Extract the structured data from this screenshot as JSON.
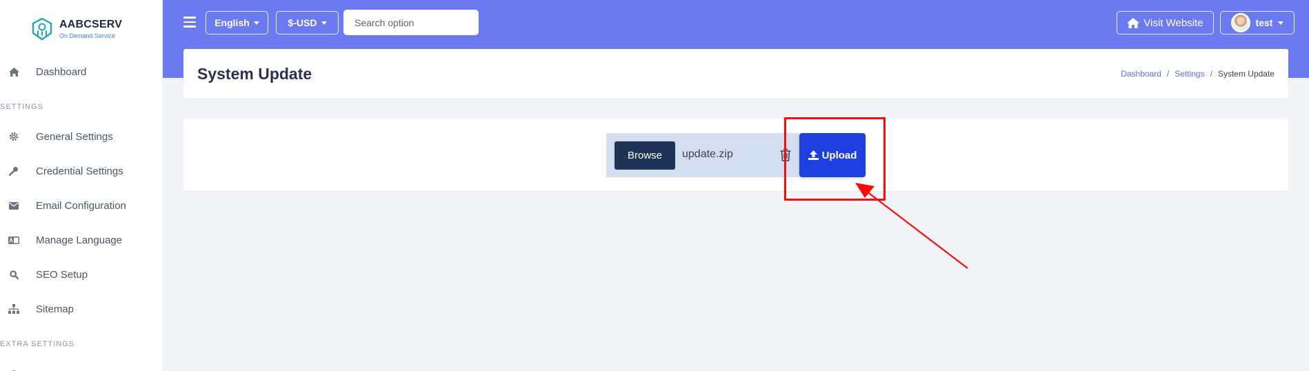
{
  "brand": {
    "name": "AABCSERV",
    "tagline": "On Demand Service"
  },
  "sidebar": {
    "items": [
      {
        "label": "Dashboard",
        "icon": "home-icon"
      },
      {
        "label": "General Settings",
        "icon": "gear-icon"
      },
      {
        "label": "Credential Settings",
        "icon": "key-icon"
      },
      {
        "label": "Email Configuration",
        "icon": "envelope-icon"
      },
      {
        "label": "Manage Language",
        "icon": "language-icon"
      },
      {
        "label": "SEO Setup",
        "icon": "search-icon"
      },
      {
        "label": "Sitemap",
        "icon": "sitemap-icon"
      },
      {
        "label": "",
        "icon": "plug-icon"
      }
    ],
    "sections": {
      "settings": "SETTINGS",
      "extra": "EXTRA SETTINGS"
    }
  },
  "topbar": {
    "language": "English",
    "currency": "$-USD",
    "search_placeholder": "Search option",
    "visit_website": "Visit Website",
    "user": "test"
  },
  "page": {
    "title": "System Update",
    "breadcrumb": {
      "home": "Dashboard",
      "settings": "Settings",
      "current": "System Update",
      "separator": "/"
    }
  },
  "upload": {
    "browse_label": "Browse",
    "file_name": "update.zip",
    "upload_label": "Upload"
  },
  "colors": {
    "topbar": "#6b7bef",
    "browse": "#1e3355",
    "upload": "#1f3fe0",
    "annotation": "#ff0a0a"
  }
}
